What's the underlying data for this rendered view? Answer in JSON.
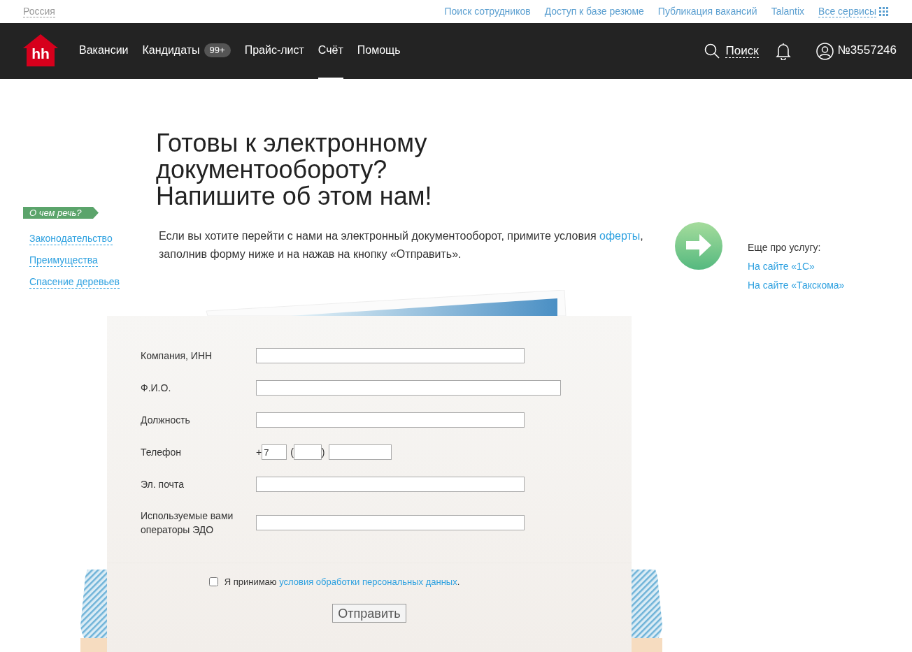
{
  "top_bar": {
    "region": "Россия",
    "links": [
      {
        "label": "Поиск сотрудников"
      },
      {
        "label": "Доступ к базе резюме"
      },
      {
        "label": "Публикация вакансий"
      },
      {
        "label": "Talantix"
      }
    ],
    "all_services": "Все сервисы"
  },
  "nav": {
    "logo": "hh",
    "items": [
      {
        "label": "Вакансии",
        "selected": false
      },
      {
        "label": "Кандидаты",
        "badge": "99+",
        "selected": false
      },
      {
        "label": "Прайс-лист",
        "selected": false
      },
      {
        "label": "Счёт",
        "selected": true
      },
      {
        "label": "Помощь",
        "selected": false
      }
    ],
    "search": "Поиск",
    "account": "№3557246"
  },
  "sidebar": {
    "tag": "О чем речь?",
    "links": [
      "Законодательство",
      "Преимущества",
      "Спасение деревьев"
    ]
  },
  "heading": [
    "Готовы к электронному",
    "документообороту?",
    "Напишите об этом нам!"
  ],
  "intro": {
    "before": "Если вы хотите перейти с нами на электронный документооборот, примите условия ",
    "link": "оферты",
    "after": ", заполнив форму ниже и на нажав на кнопку «Отправить»."
  },
  "more": {
    "title": "Еще про услугу:",
    "links": [
      "На сайте «1С»",
      "На сайте «Такскома»"
    ]
  },
  "form": {
    "fields": [
      {
        "kind": "text",
        "label": "Компания, ИНН",
        "wide": false
      },
      {
        "kind": "text",
        "label": "Ф.И.О.",
        "wide": true
      },
      {
        "kind": "text",
        "label": "Должность",
        "wide": false
      },
      {
        "kind": "phone",
        "label": "Телефон",
        "plus": "+",
        "country": "7",
        "open": "(",
        "close": ")"
      },
      {
        "kind": "text",
        "label": "Эл. почта",
        "wide": false
      },
      {
        "kind": "text",
        "label": "Используемые вами операторы ЭДО",
        "wide": false
      }
    ],
    "consent": {
      "checked": false,
      "before": "Я принимаю ",
      "link": "условия обработки персональных данных",
      "after": "."
    },
    "submit": "Отправить"
  }
}
